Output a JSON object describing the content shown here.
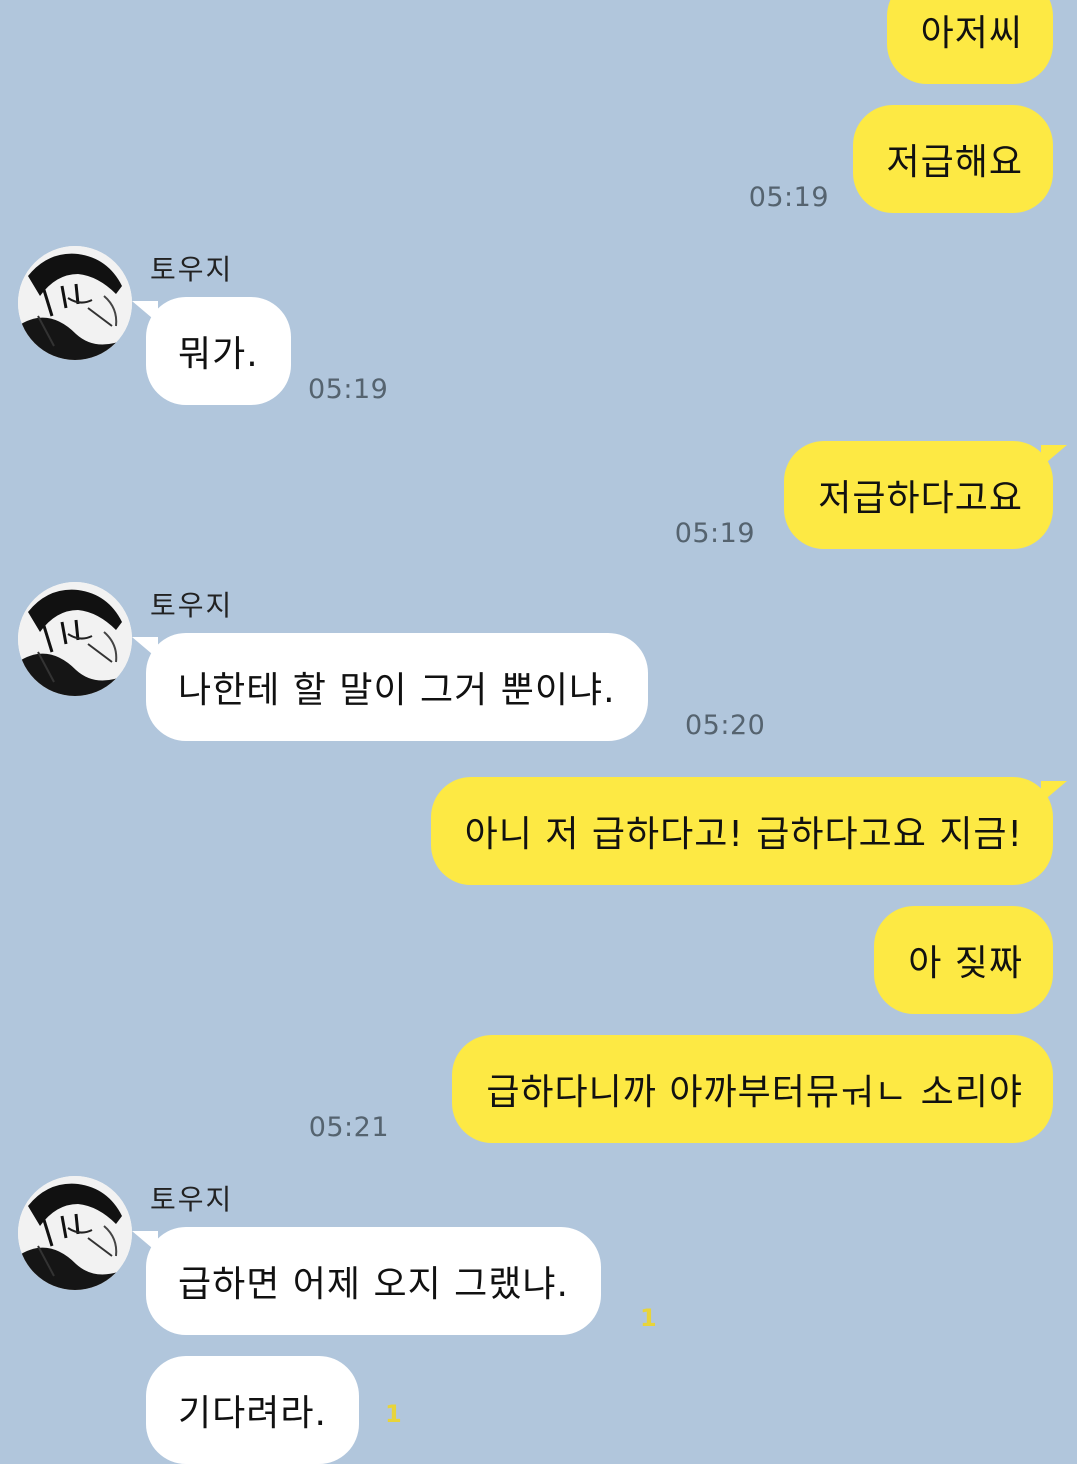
{
  "contact": {
    "name": "토우지",
    "avatar_icon": "manga-portrait-avatar"
  },
  "colors": {
    "background": "#b1c6dc",
    "my_bubble": "#fde944",
    "their_bubble": "#ffffff",
    "unread": "#e8d43a"
  },
  "messages": [
    {
      "sender": "me",
      "text": "아저씨",
      "time": ""
    },
    {
      "sender": "me",
      "text": "저급해요",
      "time": "05:19"
    },
    {
      "sender": "them",
      "text": "뭐가.",
      "time": "05:19"
    },
    {
      "sender": "me",
      "text": "저급하다고요",
      "time": "05:19"
    },
    {
      "sender": "them",
      "text": "나한테 할 말이 그거 뿐이냐.",
      "time": "05:20"
    },
    {
      "sender": "me",
      "text": "아니 저 급하다고! 급하다고요 지금!",
      "time": ""
    },
    {
      "sender": "me",
      "text": "아 짖짜",
      "time": ""
    },
    {
      "sender": "me",
      "text": "급하다니까 아까부터뮤ㅝㄴ 소리야",
      "time": "05:21"
    },
    {
      "sender": "them",
      "text": "급하면 어제 오지 그랬냐.",
      "time": "",
      "unread": "1"
    },
    {
      "sender": "them",
      "text": "기다려라.",
      "time": "",
      "unread": "1"
    }
  ]
}
